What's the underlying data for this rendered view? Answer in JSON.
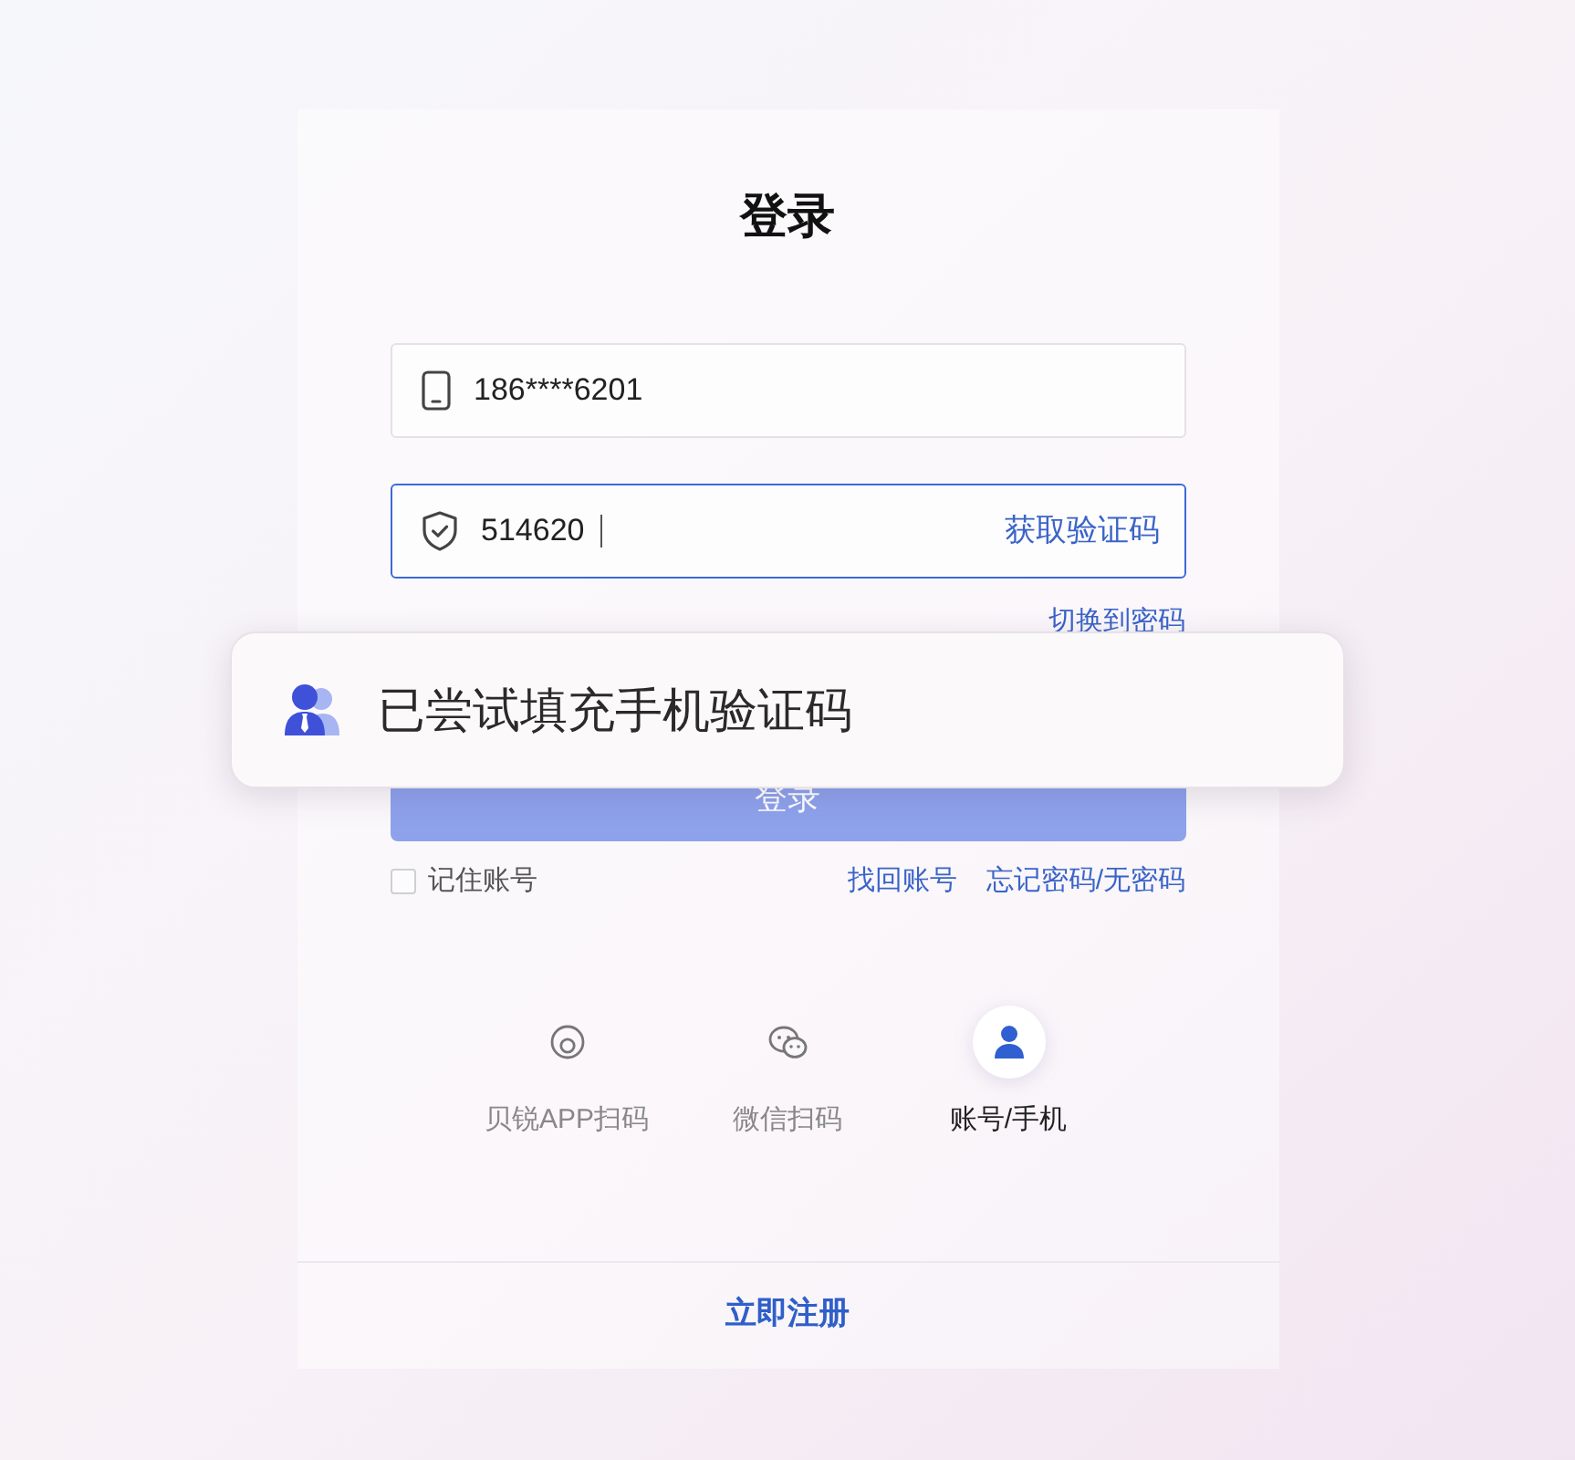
{
  "title": "登录",
  "fields": [
    {
      "kind": "phone",
      "value": "186****6201",
      "focused": false
    },
    {
      "kind": "code",
      "value": "514620",
      "focused": true,
      "action": "获取验证码"
    }
  ],
  "switch_link": "切换到密码",
  "toast": {
    "message": "已尝试填充手机验证码"
  },
  "login_button": {
    "label": "登录",
    "disabled": true
  },
  "remember": {
    "label": "记住账号",
    "checked": false
  },
  "links": [
    "找回账号",
    "忘记密码/无密码"
  ],
  "login_methods": [
    {
      "kind": "app_scan",
      "label": "贝锐APP扫码",
      "selected": false
    },
    {
      "kind": "wechat_scan",
      "label": "微信扫码",
      "selected": false
    },
    {
      "kind": "account",
      "label": "账号/手机",
      "selected": true
    }
  ],
  "register_link": "立即注册"
}
